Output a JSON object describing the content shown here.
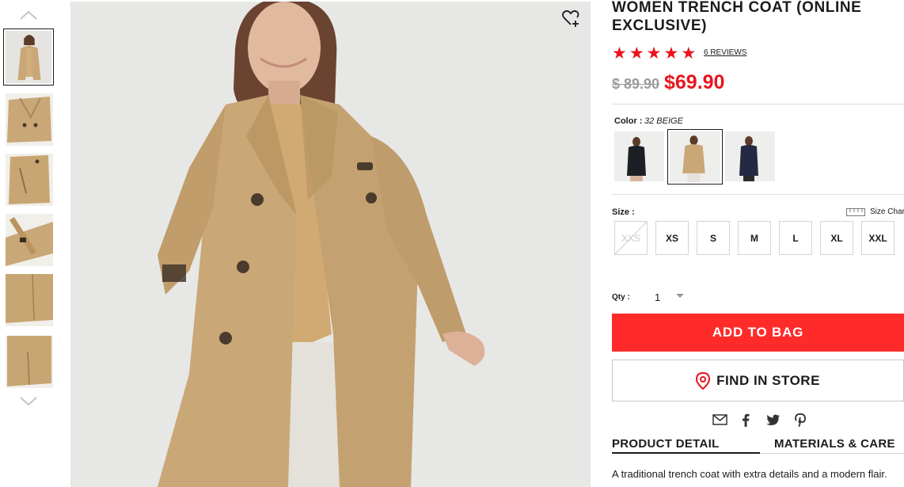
{
  "product": {
    "title": "WOMEN TRENCH COAT (ONLINE EXCLUSIVE)",
    "rating_stars": 5,
    "reviews_label": "6 REVIEWS",
    "old_price": "$ 89.90",
    "new_price": "$69.90",
    "description": "A traditional trench coat with extra details and a modern flair."
  },
  "colors": {
    "accent_red": "#e8141d",
    "button_red": "#ff2b2b",
    "coat_beige": "#c9a777"
  },
  "gallery": {
    "thumbnails": [
      "front-view",
      "collar-detail",
      "pocket-detail",
      "belt-detail",
      "hem-detail",
      "back-vent-detail"
    ],
    "selected_index": 0
  },
  "color_option": {
    "label": "Color :",
    "value": "32 BEIGE",
    "swatches": [
      "black",
      "beige",
      "navy"
    ],
    "selected": "beige"
  },
  "size_option": {
    "label": "Size :",
    "chart_label": "Size Chart",
    "sizes": [
      "XXS",
      "XS",
      "S",
      "M",
      "L",
      "XL",
      "XXL"
    ],
    "unavailable": [
      "XXS"
    ]
  },
  "quantity": {
    "label": "Qty :",
    "value": "1"
  },
  "actions": {
    "add_to_bag": "ADD TO BAG",
    "find_in_store": "FIND IN STORE"
  },
  "share_icons": [
    "mail-icon",
    "facebook-icon",
    "twitter-icon",
    "pinterest-icon"
  ],
  "tabs": {
    "product_detail": "PRODUCT DETAIL",
    "materials_care": "MATERIALS & CARE",
    "active": "product_detail"
  }
}
